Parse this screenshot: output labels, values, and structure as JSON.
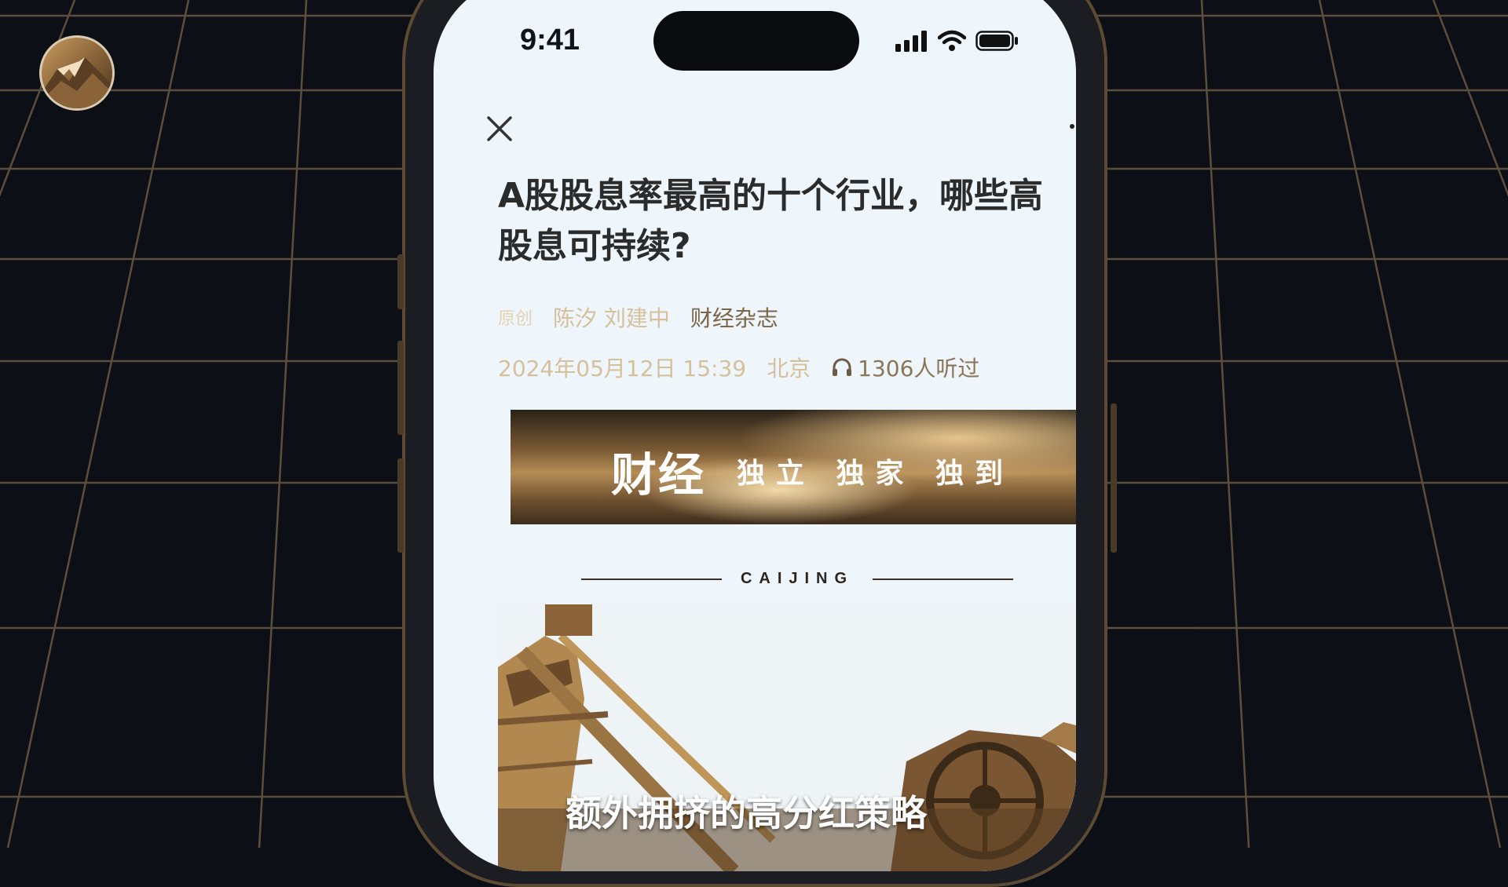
{
  "status_bar": {
    "time": "9:41"
  },
  "article": {
    "title_line1": "A股股息率最高的十个行业，哪些高",
    "title_line2": "股息可持续?",
    "tag": "原创",
    "authors": "陈汐 刘建中",
    "source": "财经杂志",
    "date": "2024年05月12日 15:39",
    "location": "北京",
    "listen_count": "1306人听过"
  },
  "banner": {
    "logo": "财经",
    "slogan": "独立 独家 独到",
    "caption": "CAIJING"
  },
  "subtitle": "额外拥挤的高分红策略",
  "icons": {
    "close": "close-icon",
    "headphones": "headphones-icon",
    "signal": "signal-icon",
    "wifi": "wifi-icon",
    "battery": "battery-icon",
    "more": "more-icon"
  },
  "colors": {
    "background": "#0c0f15",
    "grid_line": "#6b5a45",
    "screen": "#eff6fb",
    "accent_gold": "#d4c09a",
    "title_text": "#2b2b2b"
  }
}
